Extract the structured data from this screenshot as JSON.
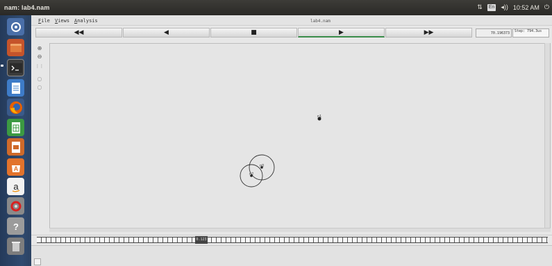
{
  "window": {
    "title": "nam: lab4.nam"
  },
  "tray": {
    "keyboard": "En",
    "volume_icon": "◂))",
    "clock": "10:52 AM"
  },
  "menu": {
    "file": "File",
    "views": "Views",
    "analysis": "Analysis",
    "filename": "lab4.nam"
  },
  "playback": {
    "rewind": "◀◀",
    "back": "◀",
    "stop": "■",
    "play": "▶",
    "fastforward": "▶▶",
    "time": "70.196373",
    "step": "Step: 794.3us"
  },
  "nodes": {
    "n1": "n1",
    "n0": "n0",
    "n2": "n2"
  },
  "timeline": {
    "marker": "0.123"
  },
  "colors": {
    "panel": "#2c2b28",
    "launcher": "#2d4668",
    "play_active": "#3a8c4a"
  }
}
